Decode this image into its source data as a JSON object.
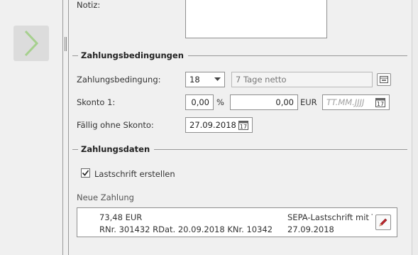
{
  "notes": {
    "label": "Notiz:"
  },
  "sections": {
    "payment_terms": "Zahlungsbedingungen",
    "payment_data": "Zahlungsdaten"
  },
  "payment_terms": {
    "term_label": "Zahlungsbedingung:",
    "term_code": "18",
    "term_description": "7 Tage netto",
    "discount_label": "Skonto 1:",
    "discount_percent": "0,00",
    "percent_unit": "%",
    "discount_amount": "0,00",
    "currency_unit": "EUR",
    "discount_date_placeholder": "TT.MM.JJJJ",
    "due_label": "Fällig ohne Skonto:",
    "due_date": "27.09.2018"
  },
  "payment_data": {
    "direct_debit_label": "Lastschrift erstellen",
    "direct_debit_checked": true,
    "new_payment_label": "Neue Zahlung",
    "payment": {
      "amount": "73,48 EUR",
      "reference": "RNr. 301432 RDat. 20.09.2018 KNr. 10342",
      "method": "SEPA-Lastschrift mit T",
      "date": "27.09.2018"
    }
  },
  "colors": {
    "background": "#f0f0f0",
    "chevron": "#a6d08e",
    "edit_pencil": "#c0262d"
  },
  "icons": [
    "chevron-right-icon",
    "lookup-icon",
    "calendar-icon",
    "checkmark-icon",
    "pencil-icon"
  ]
}
